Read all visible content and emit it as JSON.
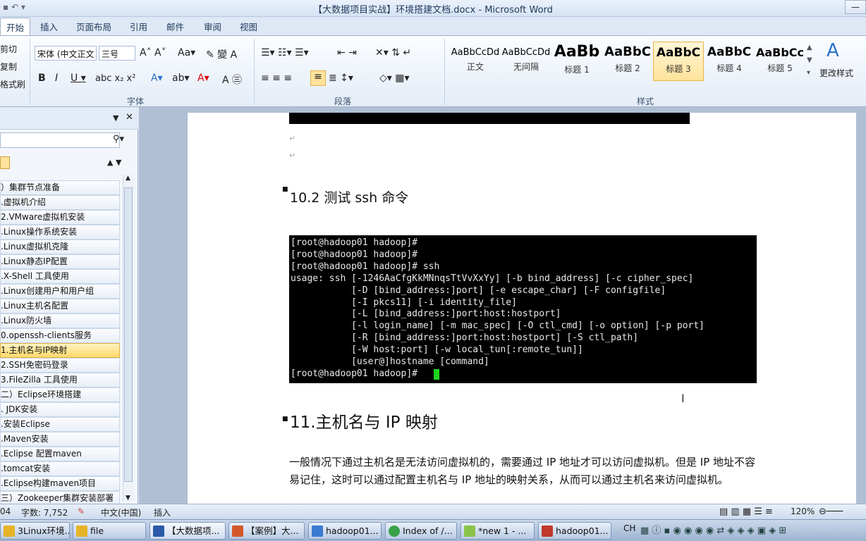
{
  "window": {
    "title": "【大数据项目实战】环境搭建文档.docx - Microsoft Word"
  },
  "ribbon": {
    "tabs": [
      "开始",
      "插入",
      "页面布局",
      "引用",
      "邮件",
      "审阅",
      "视图"
    ],
    "clipboard": [
      "剪切",
      "复制",
      "格式刷"
    ],
    "font_name": "宋体 (中文正文",
    "font_size": "三号",
    "group_font": "字体",
    "group_paragraph": "段落",
    "group_styles": "样式",
    "styles": [
      {
        "sample": "AaBbCcDd",
        "name": "正文"
      },
      {
        "sample": "AaBbCcDd",
        "name": "无间隔"
      },
      {
        "sample": "AaBb",
        "name": "标题 1"
      },
      {
        "sample": "AaBbC",
        "name": "标题 2"
      },
      {
        "sample": "AaBbC",
        "name": "标题 3"
      },
      {
        "sample": "AaBbC",
        "name": "标题 4"
      },
      {
        "sample": "AaBbCc",
        "name": "标题 5"
      }
    ],
    "change_styles": "更改样式"
  },
  "nav": {
    "items": [
      "）集群节点准备",
      ".虚拟机介绍",
      "2.VMware虚拟机安装",
      ".Linux操作系统安装",
      ".Linux虚拟机克隆",
      ".Linux静态IP配置",
      ".X-Shell 工具使用",
      ".Linux创建用户和用户组",
      ".Linux主机名配置",
      ".Linux防火墙",
      "0.openssh-clients服务",
      "1.主机名与IP映射",
      "2.SSH免密码登录",
      "3.FileZilla 工具使用",
      "二）Eclipse环境搭建",
      ". JDK安装",
      ".安装Eclipse",
      ".Maven安装",
      ".Eclipse 配置maven",
      ".tomcat安装",
      ".Eclipse构建maven项目",
      "三）Zookeeper集群安装部署"
    ],
    "selected_index": 11
  },
  "doc": {
    "heading_ssh": "10.2 测试 ssh 命令",
    "terminal": "[root@hadoop01 hadoop]#\n[root@hadoop01 hadoop]#\n[root@hadoop01 hadoop]# ssh\nusage: ssh [-1246AaCfgKkMNnqsTtVvXxYy] [-b bind_address] [-c cipher_spec]\n           [-D [bind_address:]port] [-e escape_char] [-F configfile]\n           [-I pkcs11] [-i identity_file]\n           [-L [bind_address:]port:host:hostport]\n           [-l login_name] [-m mac_spec] [-O ctl_cmd] [-o option] [-p port]\n           [-R [bind_address:]port:host:hostport] [-S ctl_path]\n           [-W host:port] [-w local_tun[:remote_tun]]\n           [user@]hostname [command]\n[root@hadoop01 hadoop]# ",
    "heading_11": "11.主机名与 IP 映射",
    "body": "一般情况下通过主机名是无法访问虚拟机的，需要通过 IP 地址才可以访问虚拟机。但是 IP 地址不容易记住，这时可以通过配置主机名与 IP 地址的映射关系，从而可以通过主机名来访问虚拟机。"
  },
  "status": {
    "page": "04",
    "words": "字数: 7,752",
    "lang": "中文(中国)",
    "mode": "插入",
    "zoom": "120%"
  },
  "taskbar": {
    "items": [
      "3Linux环境...",
      "file",
      "【大数据项...",
      "【案例】大...",
      "hadoop01...",
      "Index of /...",
      "*new  1 - ...",
      "hadoop01..."
    ],
    "tray": "CH"
  }
}
